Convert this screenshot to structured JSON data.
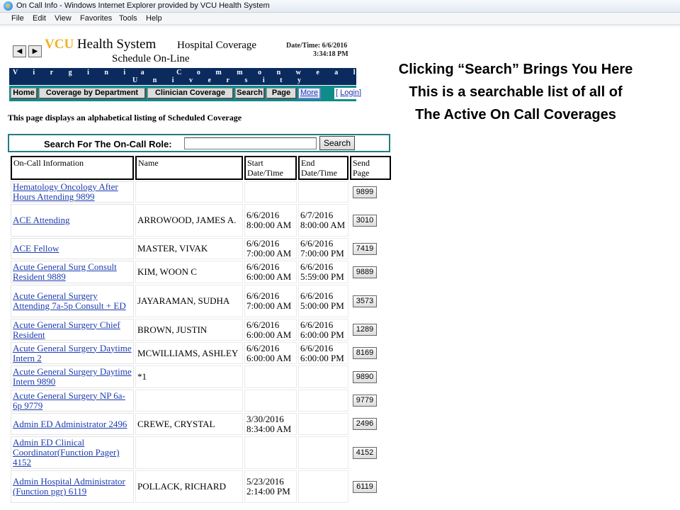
{
  "window": {
    "title": "On Call Info - Windows Internet Explorer provided by VCU Health System",
    "menu": [
      "File",
      "Edit",
      "View",
      "Favorites",
      "Tools",
      "Help"
    ]
  },
  "header": {
    "brand": "VCU",
    "brand_rest": "Health System",
    "hospital_coverage": "Hospital Coverage",
    "schedule": "Schedule On-Line",
    "datetime_label": "Date/Time: 6/6/2016",
    "datetime_time": "3:34:18 PM",
    "banner_line1": "Virginia Commonwealth",
    "banner_line2": "University",
    "nav": [
      "Home",
      "Coverage by Department",
      "Clinician Coverage",
      "Search",
      "Page",
      "More"
    ],
    "login": "Login"
  },
  "intro": "This page displays an alphabetical listing of Scheduled Coverage",
  "search": {
    "label": "Search For The On-Call Role:",
    "value": "",
    "button": "Search"
  },
  "table": {
    "headers": {
      "info": "On-Call Information",
      "name": "Name",
      "start": "Start Date/Time",
      "end": "End Date/Time",
      "send": "Send Page"
    },
    "rows": [
      {
        "info": "Hematology Oncology After Hours Attending 9899",
        "name": "",
        "start": "",
        "end": "",
        "page": "9899"
      },
      {
        "info": "ACE Attending",
        "name": "ARROWOOD, JAMES A.",
        "start": "6/6/2016 8:00:00 AM",
        "end": "6/7/2016 8:00:00 AM",
        "page": "3010"
      },
      {
        "info": "ACE Fellow",
        "name": "MASTER, VIVAK",
        "start": "6/6/2016 7:00:00 AM",
        "end": "6/6/2016 7:00:00 PM",
        "page": "7419"
      },
      {
        "info": "Acute General Surg Consult Resident 9889",
        "name": "KIM, WOON C",
        "start": "6/6/2016 6:00:00 AM",
        "end": "6/6/2016 5:59:00 PM",
        "page": "9889"
      },
      {
        "info": "Acute General Surgery Attending 7a-5p Consult + ED",
        "name": "JAYARAMAN, SUDHA",
        "start": "6/6/2016 7:00:00 AM",
        "end": "6/6/2016 5:00:00 PM",
        "page": "3573"
      },
      {
        "info": "Acute General Surgery Chief Resident",
        "name": "BROWN, JUSTIN",
        "start": "6/6/2016 6:00:00 AM",
        "end": "6/6/2016 6:00:00 PM",
        "page": "1289"
      },
      {
        "info": "Acute General Surgery Daytime Intern 2",
        "name": "MCWILLIAMS, ASHLEY",
        "start": "6/6/2016 6:00:00 AM",
        "end": "6/6/2016 6:00:00 PM",
        "page": "8169"
      },
      {
        "info": "Acute General Surgery Daytime Intern 9890",
        "name": "*1",
        "start": "",
        "end": "",
        "page": "9890"
      },
      {
        "info": "Acute General Surgery NP 6a-6p 9779",
        "name": "",
        "start": "",
        "end": "",
        "page": "9779"
      },
      {
        "info": "Admin ED Administrator 2496",
        "name": "CREWE, CRYSTAL",
        "start": "3/30/2016 8:34:00 AM",
        "end": "",
        "page": "2496"
      },
      {
        "info": "Admin ED Clinical Coordinator(Function Pager) 4152",
        "name": "",
        "start": "",
        "end": "",
        "page": "4152"
      },
      {
        "info": "Admin Hospital Administrator (Function pgr) 6119",
        "name": "POLLACK, RICHARD",
        "start": "5/23/2016 2:14:00 PM",
        "end": "",
        "page": "6119"
      }
    ]
  },
  "annotation": {
    "line1": "Clicking “Search” Brings You Here",
    "line2": "This is a searchable list of all of",
    "line3": "The Active On Call Coverages"
  }
}
